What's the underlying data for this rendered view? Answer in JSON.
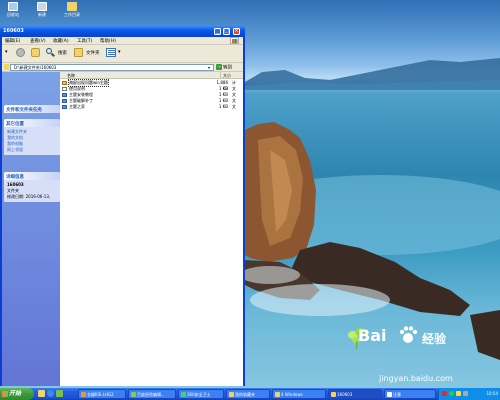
{
  "desktop": {
    "icons": [
      {
        "label": "回收站",
        "icon": "recycle-bin-icon"
      },
      {
        "label": "新建",
        "icon": "computer-icon"
      },
      {
        "label": "工作目录",
        "icon": "folder-icon"
      }
    ]
  },
  "window": {
    "title": "160603",
    "menu": [
      "编辑(E)",
      "查看(V)",
      "收藏(A)",
      "工具(T)",
      "帮助(H)"
    ],
    "toolbar": {
      "search": "搜索",
      "folders": "文件夹"
    },
    "address": {
      "value": "D:\\新建文件夹\\160603",
      "go": "转到"
    },
    "taskpane": {
      "file_tasks": {
        "title": "文件和文件夹任务"
      },
      "other_places": {
        "title": "其它位置",
        "items": [
          "新建文件夹",
          "我的文档",
          "我的电脑",
          "网上邻居"
        ]
      },
      "details": {
        "title": "详细信息",
        "name": "160603",
        "type": "文件夹",
        "date": "修改日期: 2016-06-13,"
      }
    },
    "columns": {
      "name": "名称",
      "size": "大小"
    },
    "files": [
      {
        "name": "海屏出现问题win主题",
        "size": "1,886 KB",
        "type": "计",
        "icon": "zip-icon",
        "selected": true
      },
      {
        "name": "使用说明",
        "size": "1 KB",
        "type": "文",
        "icon": "text-file-icon",
        "selected": false
      },
      {
        "name": "主题安装教程",
        "size": "1 KB",
        "type": "文",
        "icon": "shortcut-icon",
        "selected": false
      },
      {
        "name": "主题破解补丁",
        "size": "1 KB",
        "type": "文",
        "icon": "shortcut-icon",
        "selected": false
      },
      {
        "name": "主题之家",
        "size": "1 KB",
        "type": "文",
        "icon": "shortcut-icon",
        "selected": false
      }
    ]
  },
  "taskbar": {
    "start": "开始",
    "tasks": [
      {
        "label": "金蝶KIS-LHG2",
        "icon": "app-icon"
      },
      {
        "label": "百度经验编辑...",
        "icon": "browser-icon"
      },
      {
        "label": "360安全卫士",
        "icon": "shield-icon"
      },
      {
        "label": "我的收藏夹",
        "icon": "folder-icon"
      },
      {
        "label": "4 Windows",
        "icon": "windows-icon"
      },
      {
        "label": "160603",
        "icon": "folder-icon"
      },
      {
        "label": "注意",
        "icon": "document-icon"
      }
    ],
    "clock": "10:54"
  },
  "watermark": {
    "brand": "Bai",
    "brand2": "经验",
    "url": "jingyan.baidu.com"
  },
  "colors": {
    "titlebar": "#0a56e6",
    "taskbar": "#245edc",
    "start": "#3b9a3b",
    "taskpane": "#6375d6",
    "sea": "#2d86b0"
  }
}
